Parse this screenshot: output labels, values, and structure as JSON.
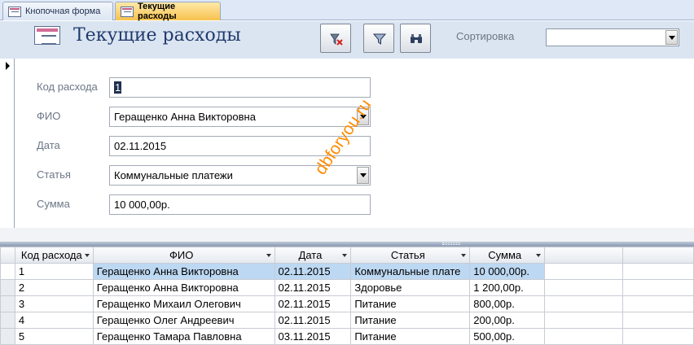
{
  "tabs": [
    {
      "label": "Кнопочная форма",
      "active": false
    },
    {
      "label": "Текущие расходы",
      "active": true
    }
  ],
  "header": {
    "title": "Текущие расходы",
    "tools": [
      {
        "icon": "remove-filter-icon"
      },
      {
        "icon": "filter-icon"
      },
      {
        "icon": "find-icon"
      }
    ],
    "sort_label": "Сортировка",
    "sort_value": ""
  },
  "detail": {
    "code_label": "Код расхода",
    "code_value": "1",
    "fio_label": "ФИО",
    "fio_value": "Геращенко Анна Викторовна",
    "date_label": "Дата",
    "date_value": "02.11.2015",
    "article_label": "Статья",
    "article_value": "Коммунальные платежи",
    "sum_label": "Сумма",
    "sum_value": "10 000,00р."
  },
  "watermark": "dbforyou.ru",
  "datasheet": {
    "columns": [
      "Код расхода",
      "ФИО",
      "Дата",
      "Статья",
      "Сумма"
    ],
    "rows": [
      {
        "code": "1",
        "fio": "Геращенко Анна Викторовна",
        "date": "02.11.2015",
        "article": "Коммунальные плате",
        "sum": "10 000,00р."
      },
      {
        "code": "2",
        "fio": "Геращенко Анна Викторовна",
        "date": "02.11.2015",
        "article": "Здоровье",
        "sum": "1 200,00р."
      },
      {
        "code": "3",
        "fio": "Геращенко Михаил Олегович",
        "date": "02.11.2015",
        "article": "Питание",
        "sum": "800,00р."
      },
      {
        "code": "4",
        "fio": "Геращенко Олег Андреевич",
        "date": "02.11.2015",
        "article": "Питание",
        "sum": "200,00р."
      },
      {
        "code": "5",
        "fio": "Геращенко Тамара Павловна",
        "date": "03.11.2015",
        "article": "Питание",
        "sum": "500,00р."
      }
    ]
  }
}
